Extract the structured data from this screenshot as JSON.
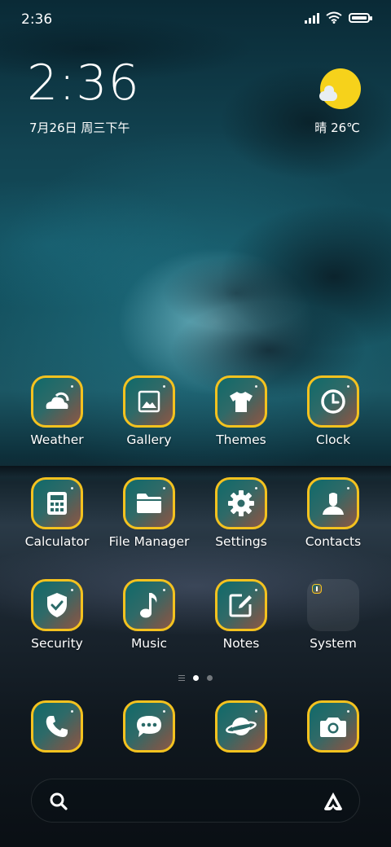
{
  "status_bar": {
    "time": "2:36"
  },
  "clock_widget": {
    "time": "2:36",
    "date": "7月26日 周三下午"
  },
  "weather_widget": {
    "text": "晴 26℃",
    "sun_color": "#f6d21b"
  },
  "apps": [
    {
      "label": "Weather",
      "icon": "weather-icon"
    },
    {
      "label": "Gallery",
      "icon": "gallery-icon"
    },
    {
      "label": "Themes",
      "icon": "tshirt-icon"
    },
    {
      "label": "Clock",
      "icon": "clock-icon"
    },
    {
      "label": "Calculator",
      "icon": "calculator-icon"
    },
    {
      "label": "File Manager",
      "icon": "folder-icon"
    },
    {
      "label": "Settings",
      "icon": "gear-icon"
    },
    {
      "label": "Contacts",
      "icon": "person-icon"
    },
    {
      "label": "Security",
      "icon": "shield-check-icon"
    },
    {
      "label": "Music",
      "icon": "music-note-icon"
    },
    {
      "label": "Notes",
      "icon": "note-edit-icon"
    },
    {
      "label": "System",
      "icon": "folder-icon"
    }
  ],
  "dock": [
    {
      "icon": "phone-icon"
    },
    {
      "icon": "message-icon"
    },
    {
      "icon": "browser-planet-icon"
    },
    {
      "icon": "camera-icon"
    }
  ],
  "page_indicator": {
    "pages": 2,
    "active": 1
  },
  "icon_border_color": "#f4c21f"
}
